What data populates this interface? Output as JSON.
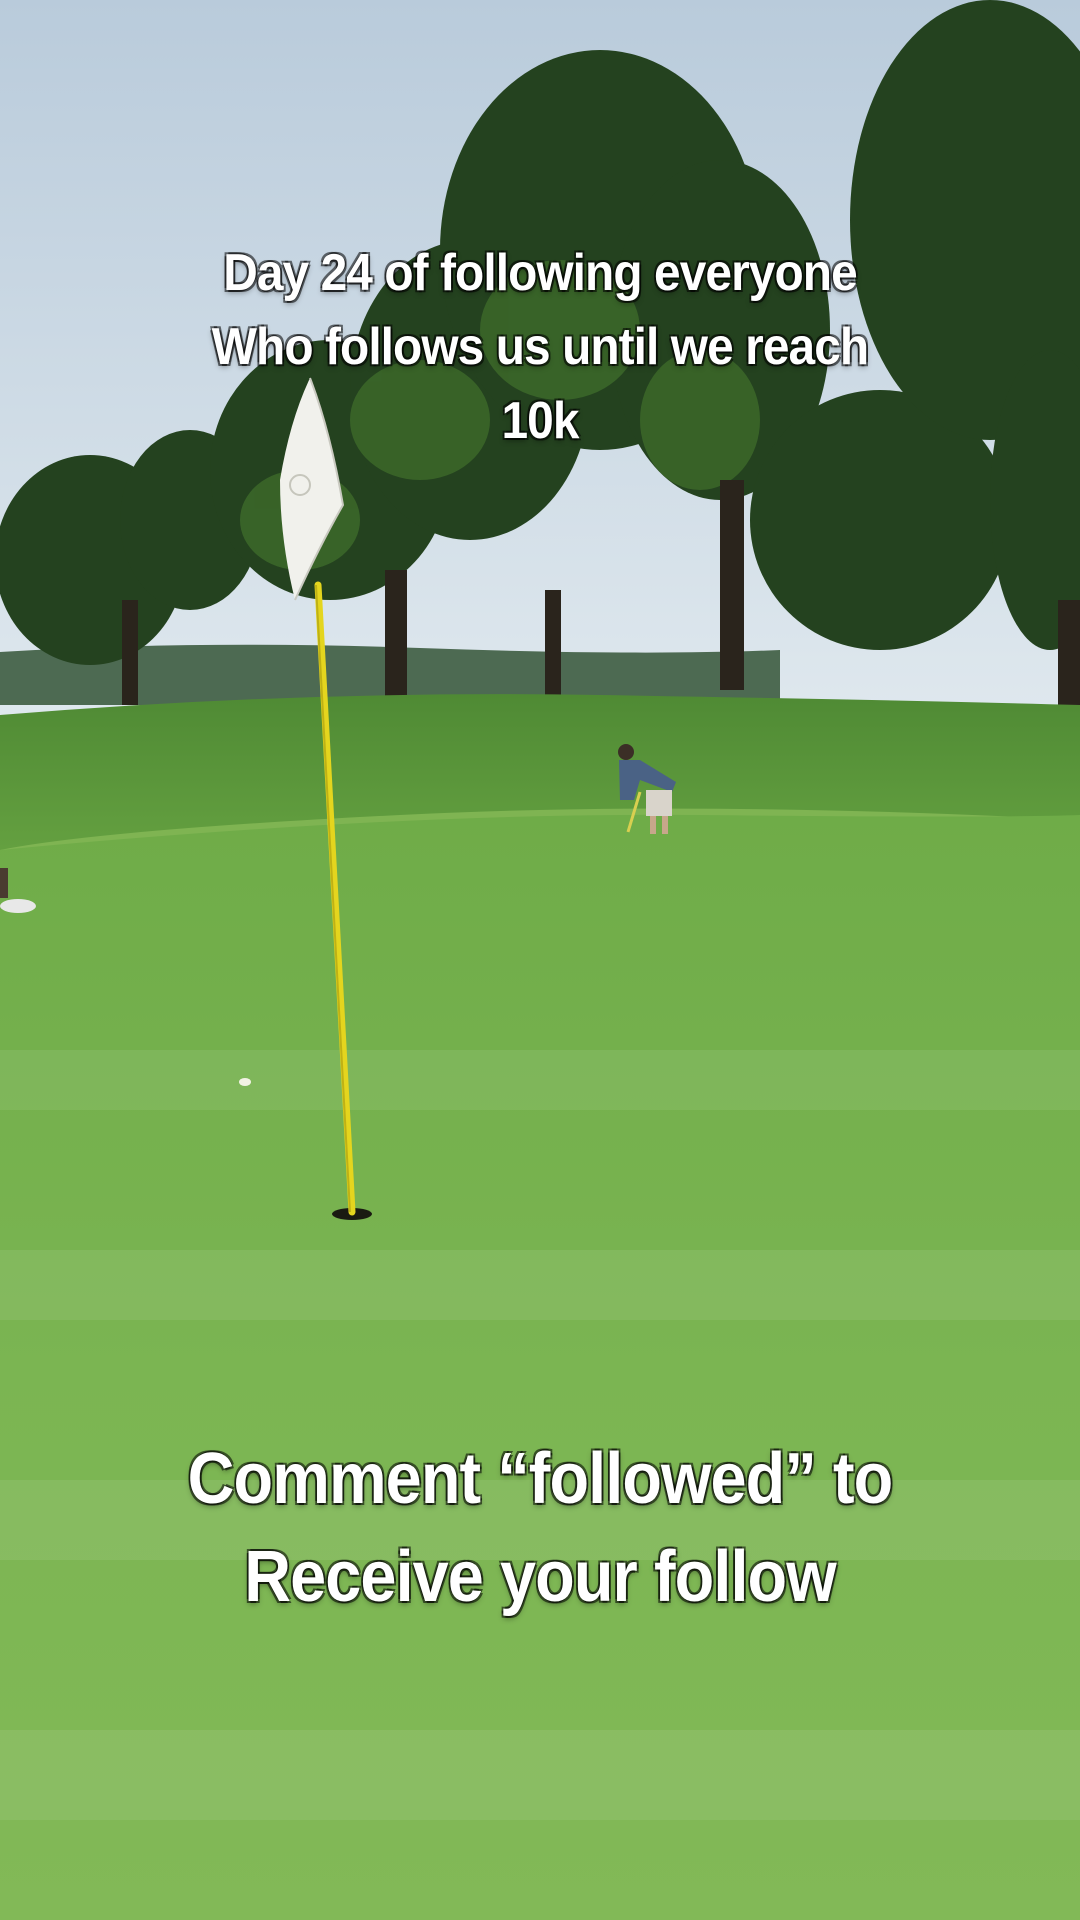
{
  "captions": {
    "top": {
      "line1": "Day  24 of following everyone",
      "line2": "Who follows us until we reach",
      "line3": "10k"
    },
    "bottom": {
      "line1": "Comment “followed” to",
      "line2": "Receive your follow"
    }
  },
  "colors": {
    "sky": "#c9d8e4",
    "tree_dark": "#1f3d1c",
    "tree_light": "#3c6a2a",
    "fairway": "#5e9a3d",
    "green": "#7db553",
    "flagstick": "#e6d81c",
    "flag": "#f2f2ee",
    "caption_text": "#ffffff"
  }
}
